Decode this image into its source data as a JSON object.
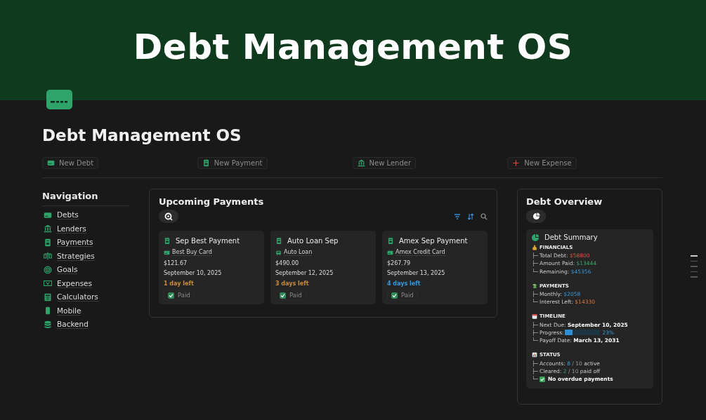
{
  "banner": {
    "title": "Debt Management OS"
  },
  "page": {
    "title": "Debt Management OS"
  },
  "actions": [
    {
      "label": "New Debt",
      "kind": "card"
    },
    {
      "label": "New Payment",
      "kind": "receipt"
    },
    {
      "label": "New Lender",
      "kind": "bank"
    },
    {
      "label": "New Expense",
      "kind": "plus"
    }
  ],
  "navigation": {
    "title": "Navigation",
    "items": [
      {
        "label": "Debts",
        "kind": "card"
      },
      {
        "label": "Lenders",
        "kind": "bank"
      },
      {
        "label": "Payments",
        "kind": "receipt"
      },
      {
        "label": "Strategies",
        "kind": "scale"
      },
      {
        "label": "Goals",
        "kind": "target"
      },
      {
        "label": "Expenses",
        "kind": "cash"
      },
      {
        "label": "Calculators",
        "kind": "calc"
      },
      {
        "label": "Mobile",
        "kind": "phone"
      },
      {
        "label": "Backend",
        "kind": "db"
      }
    ]
  },
  "payments": {
    "title": "Upcoming Payments",
    "cards": [
      {
        "title": "Sep Best Payment",
        "account": {
          "label": "Best Buy Card",
          "kind": "card"
        },
        "amount": "$121.67",
        "date": "September 10, 2025",
        "due": {
          "text": "1 day left",
          "kind": "soon"
        },
        "paid_label": "Paid",
        "paid": true
      },
      {
        "title": "Auto Loan Sep",
        "account": {
          "label": "Auto Loan",
          "kind": "car"
        },
        "amount": "$490.00",
        "date": "September 12, 2025",
        "due": {
          "text": "3 days left",
          "kind": "soon"
        },
        "paid_label": "Paid",
        "paid": true
      },
      {
        "title": "Amex Sep Payment",
        "account": {
          "label": "Amex Credit Card",
          "kind": "card"
        },
        "amount": "$267.79",
        "date": "September 13, 2025",
        "due": {
          "text": "4 days left",
          "kind": "later"
        },
        "paid_label": "Paid",
        "paid": true
      }
    ]
  },
  "overview": {
    "title": "Debt Overview",
    "summary_title": "Debt Summary",
    "sections": [
      {
        "heading": "FINANCIALS",
        "kind": "money",
        "lines": [
          {
            "branch": "├─",
            "parts": [
              {
                "text": "Total Debt: ",
                "kind": "plain"
              },
              {
                "text": "$58800",
                "kind": "red"
              }
            ]
          },
          {
            "branch": "├─",
            "parts": [
              {
                "text": "Amount Paid: ",
                "kind": "plain"
              },
              {
                "text": "$13444",
                "kind": "green"
              }
            ]
          },
          {
            "branch": "└─",
            "parts": [
              {
                "text": "Remaining: ",
                "kind": "plain"
              },
              {
                "text": "$45356",
                "kind": "blue"
              }
            ]
          }
        ]
      },
      {
        "heading": "PAYMENTS",
        "kind": "flying",
        "lines": [
          {
            "branch": "├─",
            "parts": [
              {
                "text": "Monthly: ",
                "kind": "plain"
              },
              {
                "text": "$2058",
                "kind": "blue"
              }
            ]
          },
          {
            "branch": "└─",
            "parts": [
              {
                "text": "Interest Left: ",
                "kind": "plain"
              },
              {
                "text": "$14330",
                "kind": "orange"
              }
            ]
          }
        ]
      },
      {
        "heading": "TIMELINE",
        "kind": "calendar",
        "lines": [
          {
            "branch": "├─",
            "parts": [
              {
                "text": "Next Due: ",
                "kind": "plain"
              },
              {
                "text": "September 10, 2025",
                "kind": "bold"
              }
            ]
          },
          {
            "branch": "├─",
            "parts": [
              {
                "text": "Progress: ",
                "kind": "plain"
              }
            ],
            "progress": {
              "level": 0.23,
              "reading": "23%"
            }
          },
          {
            "branch": "└─",
            "parts": [
              {
                "text": "Payoff Date: ",
                "kind": "plain"
              },
              {
                "text": "March 13, 2031",
                "kind": "bold"
              }
            ]
          }
        ]
      },
      {
        "heading": "STATUS",
        "kind": "chart",
        "lines": [
          {
            "branch": "├─",
            "parts": [
              {
                "text": "Accounts: ",
                "kind": "plain"
              },
              {
                "text": "8",
                "kind": "blue"
              },
              {
                "text": " / 10 ",
                "kind": "dim"
              },
              {
                "text": "active",
                "kind": "plain"
              }
            ]
          },
          {
            "branch": "├─",
            "parts": [
              {
                "text": "Cleared: ",
                "kind": "plain"
              },
              {
                "text": "2",
                "kind": "green"
              },
              {
                "text": " / 10 ",
                "kind": "dim"
              },
              {
                "text": "paid off",
                "kind": "plain"
              }
            ]
          },
          {
            "branch": "└─",
            "check": true,
            "parts": [
              {
                "text": "No overdue payments",
                "kind": "bold"
              }
            ]
          }
        ]
      }
    ]
  }
}
